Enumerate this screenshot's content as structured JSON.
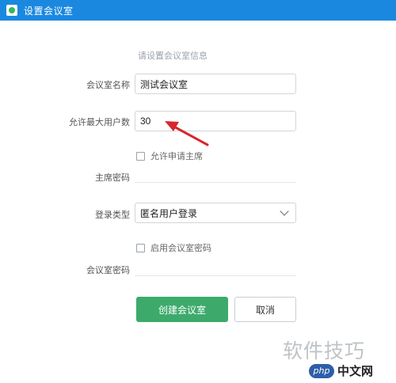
{
  "window": {
    "title": "设置会议室",
    "icon": "app-icon"
  },
  "form": {
    "section_title": "请设置会议室信息",
    "room_name": {
      "label": "会议室名称",
      "value": "测试会议室"
    },
    "max_users": {
      "label": "允许最大用户数",
      "value": "30"
    },
    "allow_apply_host": {
      "label": "允许申请主席",
      "checked": false
    },
    "host_password": {
      "label": "主席密码",
      "value": ""
    },
    "login_type": {
      "label": "登录类型",
      "selected": "匿名用户登录"
    },
    "enable_room_password": {
      "label": "启用会议室密码",
      "checked": false
    },
    "room_password": {
      "label": "会议室密码",
      "value": ""
    }
  },
  "buttons": {
    "create": "创建会议室",
    "cancel": "取消"
  },
  "annotation": {
    "arrow_color": "#d9262c"
  },
  "watermark": {
    "text": "软件技巧",
    "badge": "php",
    "site": "中文网"
  },
  "colors": {
    "titlebar": "#1b88e0",
    "primary": "#3daa6c"
  }
}
